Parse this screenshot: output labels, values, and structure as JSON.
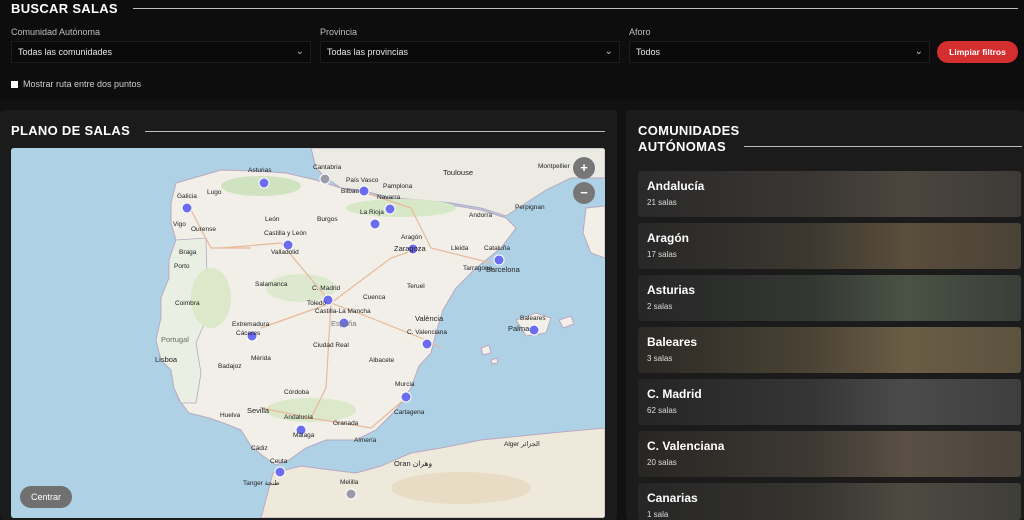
{
  "header": {
    "title": "BUSCAR SALAS"
  },
  "filters": {
    "community": {
      "label": "Comunidad Autónoma",
      "value": "Todas las comunidades"
    },
    "province": {
      "label": "Provincia",
      "value": "Todas las provincias"
    },
    "capacity": {
      "label": "Aforo",
      "value": "Todos"
    },
    "clear_label": "Limpiar filtros",
    "route_label": "Mostrar ruta entre dos puntos"
  },
  "map_section": {
    "title": "PLANO DE SALAS",
    "zoom_in": "+",
    "zoom_out": "−",
    "center_label": "Centrar",
    "labels": {
      "galicia": "Galicia",
      "asturias": "Asturias",
      "cantabria": "Cantabria",
      "pais_vasco": "País Vasco",
      "navarra": "Navarra",
      "la_rioja": "La Rioja",
      "aragon": "Aragón",
      "cataluna": "Cataluña",
      "barcelona": "Barcelona",
      "castilla_leon": "Castilla y León",
      "c_madrid": "C. Madrid",
      "castilla_la_mancha": "Castilla-La Mancha",
      "extremadura": "Extremadura",
      "c_valenciana": "C. Valenciana",
      "baleares": "Baleares",
      "palma": "Palma",
      "murcia": "Murcia",
      "andalucia": "Andalucía",
      "ceuta": "Ceuta",
      "melilla": "Melilla",
      "portugal": "Portugal",
      "lisboa": "Lisboa",
      "toulouse": "Toulouse",
      "montpellier": "Montpellier",
      "andorra": "Andorra",
      "oran": "Oran وهران",
      "tanger": "Tanger طنجة",
      "sevilla": "Sevilla",
      "valencia": "València",
      "bilbao": "Bilbao",
      "zaragoza": "Zaragoza",
      "lugo": "Lugo",
      "leon": "León",
      "burgos": "Burgos",
      "valladolid": "Valladolid",
      "salamanca": "Salamanca",
      "espana": "España",
      "coimbra": "Coimbra",
      "badajoz": "Badajoz",
      "merida": "Mérida",
      "cordoba": "Córdoba",
      "granada": "Granada",
      "malaga": "Málaga",
      "almeria": "Almería",
      "albacete": "Albacete",
      "cartagena": "Cartagena",
      "alger": "Alger الجزائر",
      "lleida": "Lleida",
      "tarragona": "Tarragona",
      "perpignan": "Perpignan",
      "pamplona": "Pamplona",
      "ciudad_real": "Ciudad Real",
      "caceres": "Cáceres",
      "huelva": "Huelva",
      "cadiz": "Cádiz",
      "toledo": "Toledo",
      "cuenca": "Cuenca",
      "teruel": "Teruel",
      "ourense": "Ourense",
      "vigo": "Vigo",
      "braga": "Braga",
      "porto": "Porto"
    }
  },
  "communities": {
    "title_line1": "COMUNIDADES",
    "title_line2": "AUTÓNOMAS",
    "items": [
      {
        "name": "Andalucía",
        "count": "21 salas"
      },
      {
        "name": "Aragón",
        "count": "17 salas"
      },
      {
        "name": "Asturias",
        "count": "2 salas"
      },
      {
        "name": "Baleares",
        "count": "3 salas"
      },
      {
        "name": "C. Madrid",
        "count": "62 salas"
      },
      {
        "name": "C. Valenciana",
        "count": "20 salas"
      },
      {
        "name": "Canarias",
        "count": "1 sala"
      }
    ]
  }
}
